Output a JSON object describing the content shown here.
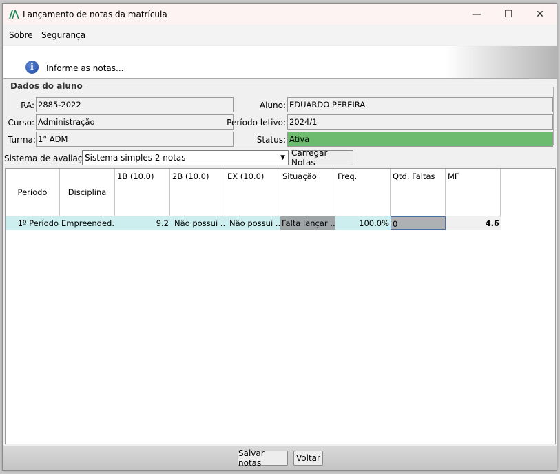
{
  "window": {
    "title": "Lançamento de notas da matrícula",
    "controls": {
      "minimize": "—",
      "maximize": "☐",
      "close": "✕"
    }
  },
  "menu": {
    "sobre": "Sobre",
    "seguranca": "Segurança"
  },
  "banner": {
    "icon": "info-icon",
    "icon_glyph": "i",
    "text": "Informe as notas..."
  },
  "aluno_group": {
    "legend": "Dados do aluno",
    "ra_label": "RA:",
    "ra_value": "2885-2022",
    "curso_label": "Curso:",
    "curso_value": "Administração",
    "turma_label": "Turma:",
    "turma_value": "1° ADM",
    "aluno_label": "Aluno:",
    "aluno_value": "EDUARDO PEREIRA",
    "periodo_label": "Período letivo:",
    "periodo_value": "2024/1",
    "status_label": "Status:",
    "status_value": "Ativa",
    "status_color": "#6dbb6e"
  },
  "sistema": {
    "label": "Sistema de avaliação:",
    "selected": "Sistema simples 2 notas",
    "load_button": "Carregar Notas"
  },
  "table": {
    "headers": [
      "Período",
      "Disciplina",
      "1B (10.0)",
      "2B (10.0)",
      "EX (10.0)",
      "Situação",
      "Freq.",
      "Qtd. Faltas",
      "MF"
    ],
    "rows": [
      [
        "1º Período",
        "Empreended...",
        "9.2",
        "Não possui ...",
        "Não possui ...",
        "Falta lançar ...",
        "100.0%",
        "0",
        "4.6"
      ]
    ]
  },
  "footer": {
    "save": "Salvar notas",
    "back": "Voltar"
  }
}
